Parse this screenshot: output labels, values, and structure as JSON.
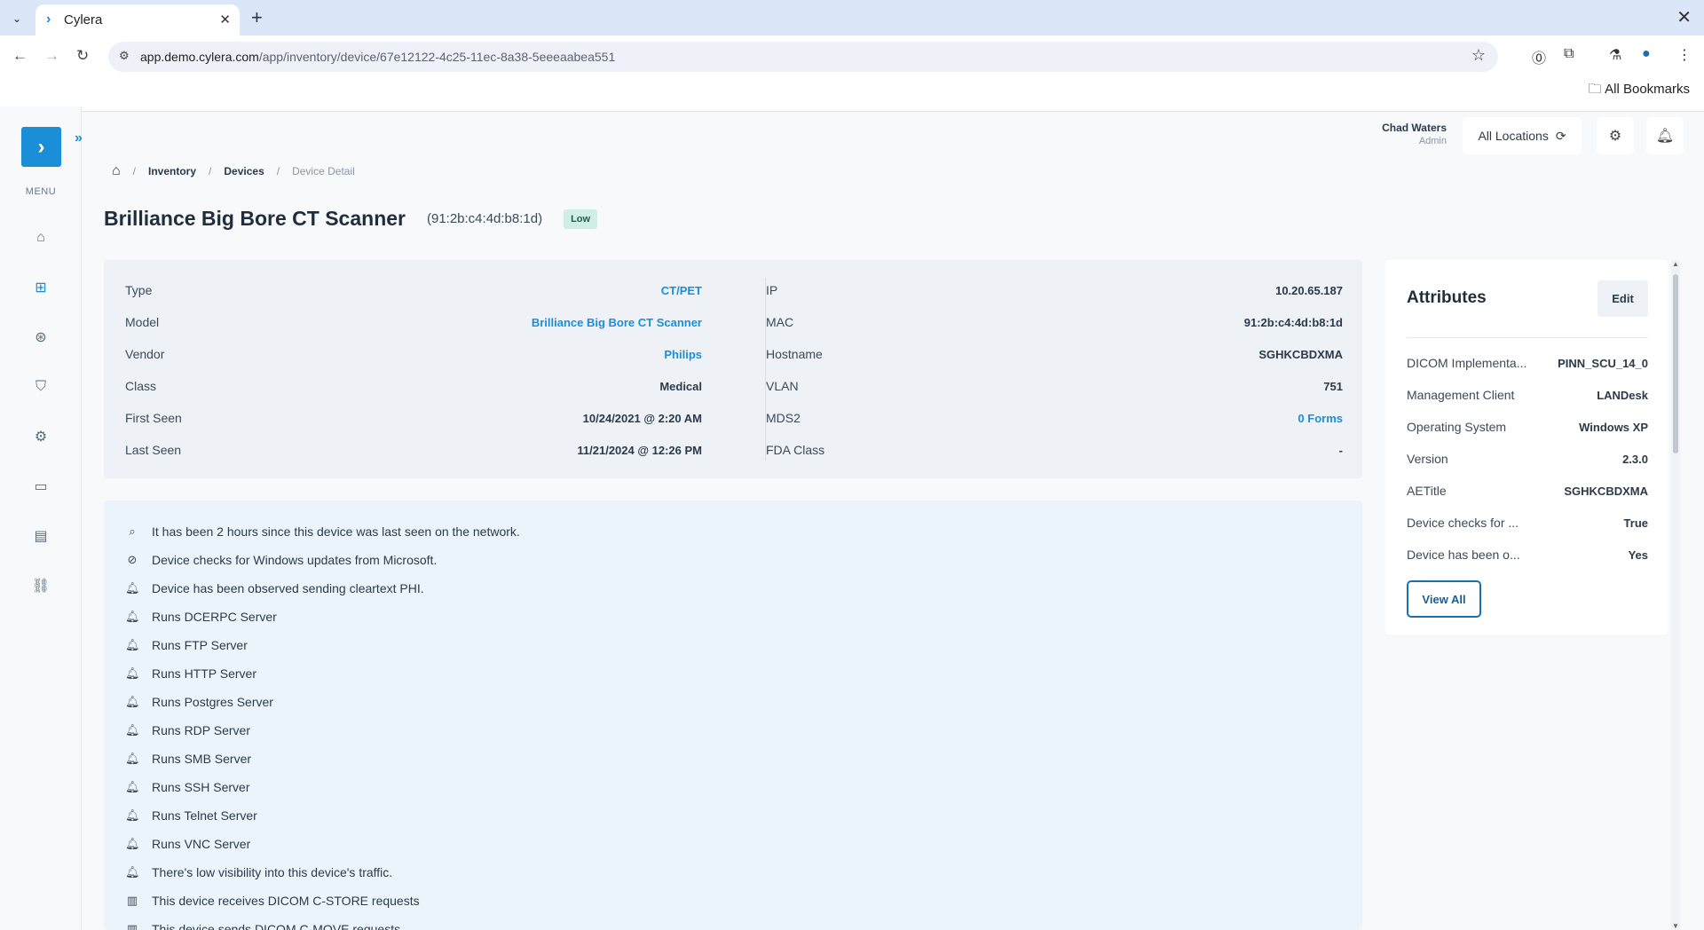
{
  "browser": {
    "tab_title": "Cylera",
    "url_domain": "app.demo.cylera.com",
    "url_path": "/app/inventory/device/67e12122-4c25-11ec-8a38-5eeeaabea551",
    "bookmarks_label": "All Bookmarks"
  },
  "sidebar": {
    "menu_label": "MENU",
    "items": [
      "home-icon",
      "inventory-icon",
      "risk-icon",
      "security-icon",
      "settings-chip-icon",
      "monitor-icon",
      "report-icon",
      "link-icon"
    ]
  },
  "header": {
    "user_name": "Chad Waters",
    "user_role": "Admin",
    "locations_label": "All Locations"
  },
  "breadcrumb": {
    "inventory": "Inventory",
    "devices": "Devices",
    "current": "Device Detail",
    "sep": "/"
  },
  "device": {
    "name": "Brilliance Big Bore CT Scanner",
    "mac_display": "(91:2b:c4:4d:b8:1d)",
    "risk": "Low"
  },
  "details": {
    "left": [
      {
        "label": "Type",
        "value": "CT/PET",
        "link": true
      },
      {
        "label": "Model",
        "value": "Brilliance Big Bore CT Scanner",
        "link": true
      },
      {
        "label": "Vendor",
        "value": "Philips",
        "link": true
      },
      {
        "label": "Class",
        "value": "Medical",
        "link": false
      },
      {
        "label": "First Seen",
        "value": "10/24/2021 @ 2:20 AM",
        "link": false
      },
      {
        "label": "Last Seen",
        "value": "11/21/2024 @ 12:26 PM",
        "link": false
      }
    ],
    "right": [
      {
        "label": "IP",
        "value": "10.20.65.187",
        "link": false
      },
      {
        "label": "MAC",
        "value": "91:2b:c4:4d:b8:1d",
        "link": false
      },
      {
        "label": "Hostname",
        "value": "SGHKCBDXMA",
        "link": false
      },
      {
        "label": "VLAN",
        "value": "751",
        "link": false
      },
      {
        "label": "MDS2",
        "value": "0 Forms",
        "link": true
      },
      {
        "label": "FDA Class",
        "value": "-",
        "link": false
      }
    ]
  },
  "insights": [
    {
      "icon": "search-icon",
      "glyph": "⌕",
      "text": "It has been 2 hours since this device was last seen on the network."
    },
    {
      "icon": "check-circle-icon",
      "glyph": "⊘",
      "text": "Device checks for Windows updates from Microsoft."
    },
    {
      "icon": "bell-icon",
      "glyph": "🔔︎",
      "text": "Device has been observed sending cleartext PHI."
    },
    {
      "icon": "bell-icon",
      "glyph": "🔔︎",
      "text": "Runs DCERPC Server"
    },
    {
      "icon": "bell-icon",
      "glyph": "🔔︎",
      "text": "Runs FTP Server"
    },
    {
      "icon": "bell-icon",
      "glyph": "🔔︎",
      "text": "Runs HTTP Server"
    },
    {
      "icon": "bell-icon",
      "glyph": "🔔︎",
      "text": "Runs Postgres Server"
    },
    {
      "icon": "bell-icon",
      "glyph": "🔔︎",
      "text": "Runs RDP Server"
    },
    {
      "icon": "bell-icon",
      "glyph": "🔔︎",
      "text": "Runs SMB Server"
    },
    {
      "icon": "bell-icon",
      "glyph": "🔔︎",
      "text": "Runs SSH Server"
    },
    {
      "icon": "bell-icon",
      "glyph": "🔔︎",
      "text": "Runs Telnet Server"
    },
    {
      "icon": "bell-icon",
      "glyph": "🔔︎",
      "text": "Runs VNC Server"
    },
    {
      "icon": "bell-icon",
      "glyph": "🔔︎",
      "text": "There's low visibility into this device's traffic."
    },
    {
      "icon": "bar-chart-icon",
      "glyph": "▥",
      "text": "This device receives DICOM C-STORE requests"
    },
    {
      "icon": "bar-chart-icon",
      "glyph": "▥",
      "text": "This device sends DICOM C-MOVE requests"
    }
  ],
  "attributes": {
    "title": "Attributes",
    "edit_label": "Edit",
    "view_all_label": "View All",
    "rows": [
      {
        "label": "DICOM Implementa...",
        "value": "PINN_SCU_14_0"
      },
      {
        "label": "Management Client",
        "value": "LANDesk"
      },
      {
        "label": "Operating System",
        "value": "Windows XP"
      },
      {
        "label": "Version",
        "value": "2.3.0"
      },
      {
        "label": "AETitle",
        "value": "SGHKCBDXMA"
      },
      {
        "label": "Device checks for ...",
        "value": "True"
      },
      {
        "label": "Device has been o...",
        "value": "Yes"
      }
    ]
  },
  "colors": {
    "accent": "#1a8fd8",
    "badge_low_bg": "#cfeee7",
    "insights_bg": "#ebf4fb"
  }
}
